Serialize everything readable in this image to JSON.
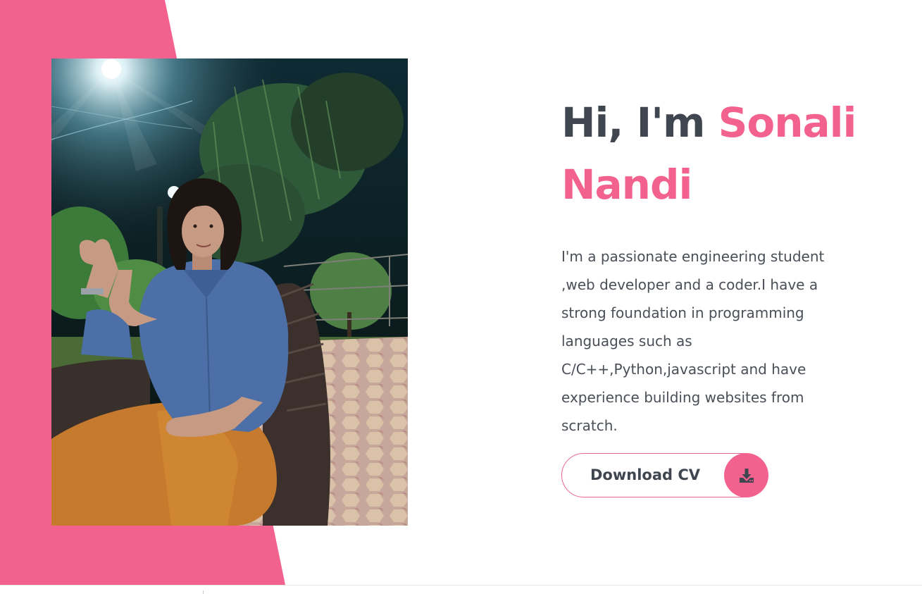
{
  "hero": {
    "greeting": "Hi, I'm",
    "first_name": "Sonali",
    "last_name": "Nandi",
    "intro_lines": [
      "I'm a passionate engineering student",
      ",web developer and a coder.I have a",
      "strong foundation in programming",
      "languages such as",
      "C/C++,Python,javascript and have",
      "experience building websites from",
      "scratch."
    ]
  },
  "cv_button": {
    "label": "Download CV",
    "icon": "download-icon"
  },
  "colors": {
    "accent": "#f3628f",
    "heading": "#3f4650",
    "body_text": "#4a4f57",
    "background": "#ffffff"
  }
}
